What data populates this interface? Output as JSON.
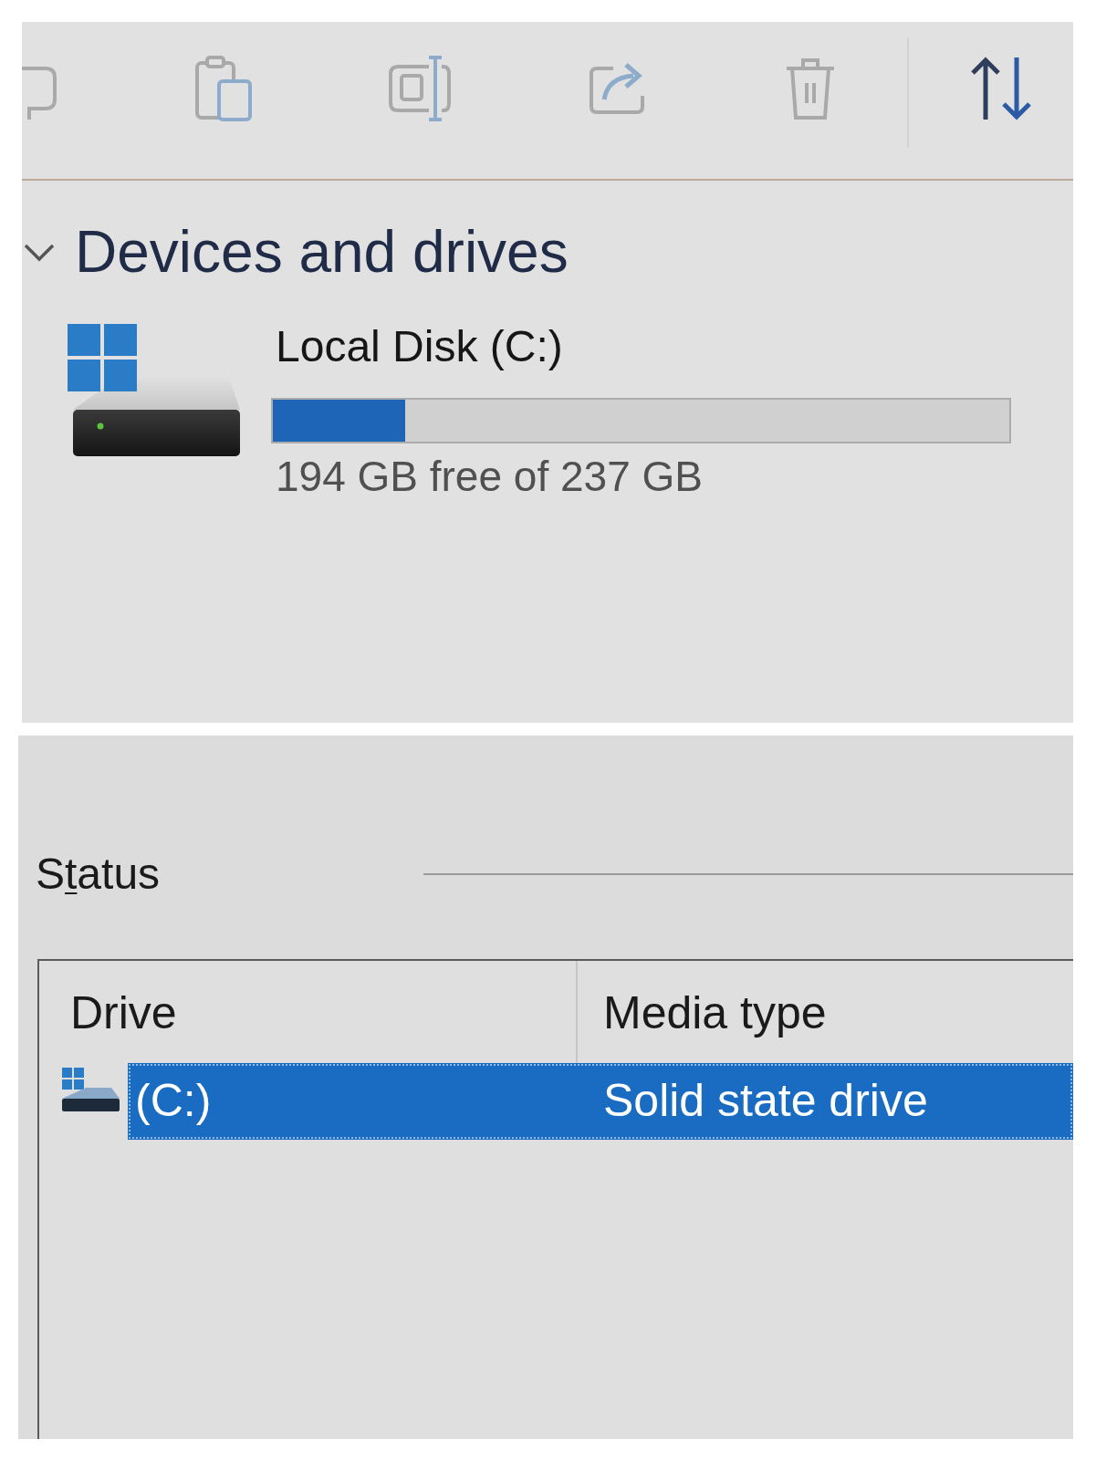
{
  "toolbar": {
    "buttons": [
      {
        "disabled": true
      },
      {
        "disabled": true
      },
      {
        "disabled": true
      },
      {
        "disabled": true
      },
      {
        "disabled": true
      },
      {
        "disabled": false
      }
    ]
  },
  "sections": [
    {
      "title": "Devices and drives",
      "expanded": true,
      "drives": [
        {
          "name": "Local Disk (C:)",
          "level": 0.18,
          "detail": "194 GB free of 237 GB"
        }
      ]
    }
  ],
  "status": {
    "label_parts": [
      {
        "text": "S",
        "underlined": false
      },
      {
        "text": "t",
        "underlined": true
      },
      {
        "text": "atus",
        "underlined": false
      }
    ]
  },
  "drive_list": {
    "columns": [
      "Drive",
      "Media type"
    ],
    "rows": [
      {
        "drive": "(C:)",
        "media_type": "Solid state drive",
        "selected": true
      }
    ]
  }
}
